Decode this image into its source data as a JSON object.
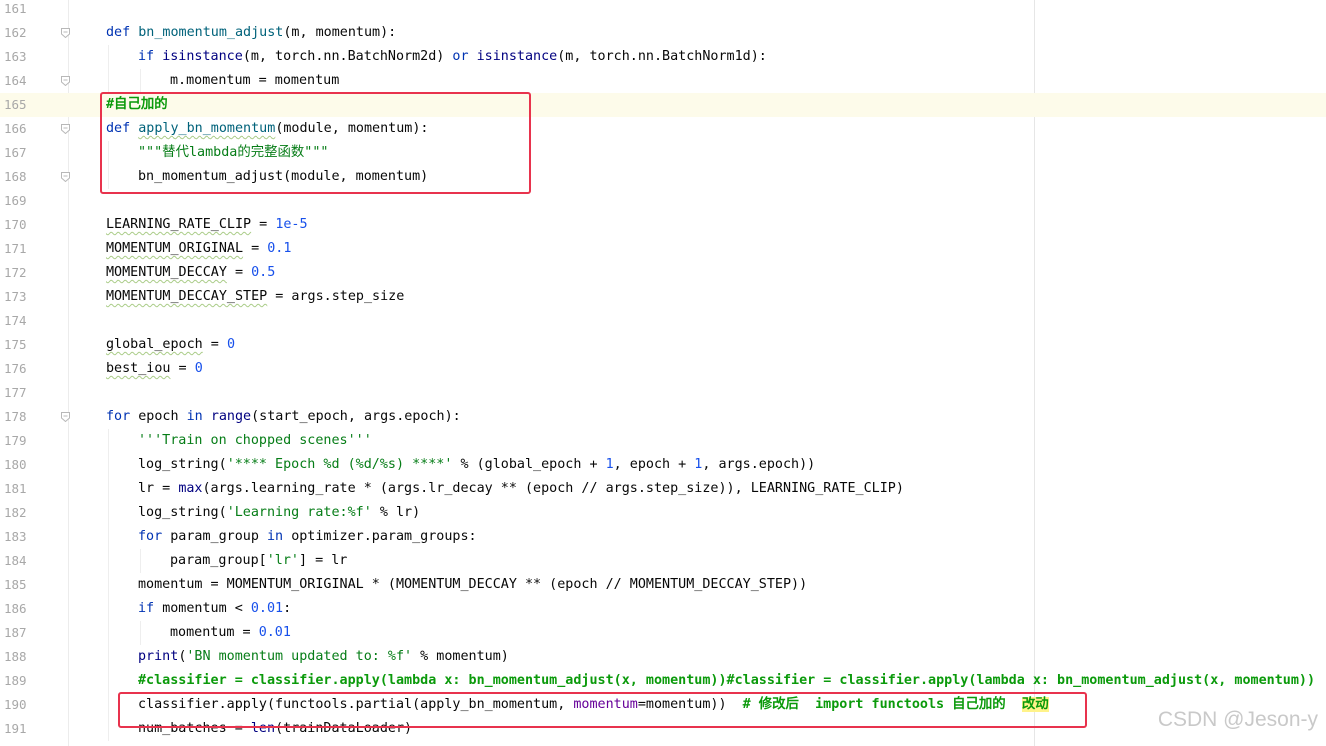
{
  "editor": {
    "lines": [
      {
        "no": "161",
        "tokens": []
      },
      {
        "no": "162",
        "tokens": [
          {
            "t": "def ",
            "c": "kw"
          },
          {
            "t": "bn_momentum_adjust",
            "c": "fn"
          },
          {
            "t": "(m, momentum):",
            "c": ""
          }
        ]
      },
      {
        "no": "163",
        "indent": 1,
        "tokens": [
          {
            "t": "if ",
            "c": "kw"
          },
          {
            "t": "isinstance",
            "c": "bi"
          },
          {
            "t": "(m, torch.nn.BatchNorm2d) ",
            "c": ""
          },
          {
            "t": "or ",
            "c": "kw"
          },
          {
            "t": "isinstance",
            "c": "bi"
          },
          {
            "t": "(m, torch.nn.BatchNorm1d):",
            "c": ""
          }
        ]
      },
      {
        "no": "164",
        "indent": 2,
        "tokens": [
          {
            "t": "m.momentum = momentum",
            "c": ""
          }
        ]
      },
      {
        "no": "165",
        "current": true,
        "tokens": [
          {
            "t": "#自己加的",
            "c": "todo"
          }
        ]
      },
      {
        "no": "166",
        "tokens": [
          {
            "t": "def ",
            "c": "kw"
          },
          {
            "t": "apply_bn_momentum",
            "c": "fn sq"
          },
          {
            "t": "(module, momentum):",
            "c": ""
          }
        ]
      },
      {
        "no": "167",
        "indent": 1,
        "tokens": [
          {
            "t": "\"\"\"替代lambda的完整函数\"\"\"",
            "c": "str"
          }
        ]
      },
      {
        "no": "168",
        "indent": 1,
        "tokens": [
          {
            "t": "bn_momentum_adjust(module, momentum)",
            "c": ""
          }
        ]
      },
      {
        "no": "169",
        "tokens": []
      },
      {
        "no": "170",
        "tokens": [
          {
            "t": "LEARNING_RATE_CLIP",
            "c": "sq"
          },
          {
            "t": " = ",
            "c": ""
          },
          {
            "t": "1e-5",
            "c": "num"
          }
        ]
      },
      {
        "no": "171",
        "tokens": [
          {
            "t": "MOMENTUM_ORIGINAL",
            "c": "sq"
          },
          {
            "t": " = ",
            "c": ""
          },
          {
            "t": "0.1",
            "c": "num"
          }
        ]
      },
      {
        "no": "172",
        "tokens": [
          {
            "t": "MOMENTUM_DECCAY",
            "c": "sq"
          },
          {
            "t": " = ",
            "c": ""
          },
          {
            "t": "0.5",
            "c": "num"
          }
        ]
      },
      {
        "no": "173",
        "tokens": [
          {
            "t": "MOMENTUM_DECCAY_STEP",
            "c": "sq"
          },
          {
            "t": " = args.step_size",
            "c": ""
          }
        ]
      },
      {
        "no": "174",
        "tokens": []
      },
      {
        "no": "175",
        "tokens": [
          {
            "t": "global_epoch",
            "c": "sq"
          },
          {
            "t": " = ",
            "c": ""
          },
          {
            "t": "0",
            "c": "num"
          }
        ]
      },
      {
        "no": "176",
        "tokens": [
          {
            "t": "best_iou",
            "c": "sq"
          },
          {
            "t": " = ",
            "c": ""
          },
          {
            "t": "0",
            "c": "num"
          }
        ]
      },
      {
        "no": "177",
        "tokens": []
      },
      {
        "no": "178",
        "tokens": [
          {
            "t": "for ",
            "c": "kw"
          },
          {
            "t": "epoch ",
            "c": ""
          },
          {
            "t": "in ",
            "c": "kw"
          },
          {
            "t": "range",
            "c": "bi"
          },
          {
            "t": "(start_epoch, args.epoch):",
            "c": ""
          }
        ]
      },
      {
        "no": "179",
        "indent": 1,
        "tokens": [
          {
            "t": "'''Train on chopped scenes'''",
            "c": "str"
          }
        ]
      },
      {
        "no": "180",
        "indent": 1,
        "tokens": [
          {
            "t": "log_string(",
            "c": ""
          },
          {
            "t": "'**** Epoch %d (%d/%s) ****'",
            "c": "str"
          },
          {
            "t": " % (global_epoch + ",
            "c": ""
          },
          {
            "t": "1",
            "c": "num"
          },
          {
            "t": ", epoch + ",
            "c": ""
          },
          {
            "t": "1",
            "c": "num"
          },
          {
            "t": ", args.epoch))",
            "c": ""
          }
        ]
      },
      {
        "no": "181",
        "indent": 1,
        "tokens": [
          {
            "t": "lr = ",
            "c": ""
          },
          {
            "t": "max",
            "c": "bi"
          },
          {
            "t": "(args.learning_rate * (args.lr_decay ** (epoch // args.step_size)), LEARNING_RATE_CLIP)",
            "c": ""
          }
        ]
      },
      {
        "no": "182",
        "indent": 1,
        "tokens": [
          {
            "t": "log_string(",
            "c": ""
          },
          {
            "t": "'Learning rate:%f'",
            "c": "str"
          },
          {
            "t": " % lr)",
            "c": ""
          }
        ]
      },
      {
        "no": "183",
        "indent": 1,
        "tokens": [
          {
            "t": "for ",
            "c": "kw"
          },
          {
            "t": "param_group ",
            "c": ""
          },
          {
            "t": "in ",
            "c": "kw"
          },
          {
            "t": "optimizer.param_groups:",
            "c": ""
          }
        ]
      },
      {
        "no": "184",
        "indent": 2,
        "tokens": [
          {
            "t": "param_group[",
            "c": ""
          },
          {
            "t": "'lr'",
            "c": "str"
          },
          {
            "t": "] = lr",
            "c": ""
          }
        ]
      },
      {
        "no": "185",
        "indent": 1,
        "tokens": [
          {
            "t": "momentum = MOMENTUM_ORIGINAL * (MOMENTUM_DECCAY ** (epoch // MOMENTUM_DECCAY_STEP))",
            "c": ""
          }
        ]
      },
      {
        "no": "186",
        "indent": 1,
        "tokens": [
          {
            "t": "if ",
            "c": "kw"
          },
          {
            "t": "momentum < ",
            "c": ""
          },
          {
            "t": "0.01",
            "c": "num"
          },
          {
            "t": ":",
            "c": ""
          }
        ]
      },
      {
        "no": "187",
        "indent": 2,
        "tokens": [
          {
            "t": "momentum = ",
            "c": ""
          },
          {
            "t": "0.01",
            "c": "num"
          }
        ]
      },
      {
        "no": "188",
        "indent": 1,
        "tokens": [
          {
            "t": "print",
            "c": "bi"
          },
          {
            "t": "(",
            "c": ""
          },
          {
            "t": "'BN momentum updated to: %f'",
            "c": "str"
          },
          {
            "t": " % momentum)",
            "c": ""
          }
        ]
      },
      {
        "no": "189",
        "indent": 1,
        "tokens": [
          {
            "t": "#classifier = classifier.apply(lambda x: bn_momentum_adjust(x, momentum))#classifier = classifier.apply(lambda x: bn_momentum_adjust(x, momentum))",
            "c": "todo"
          }
        ]
      },
      {
        "no": "190",
        "indent": 1,
        "tokens": [
          {
            "t": "classifier.apply(functools.partial(apply_bn_momentum, ",
            "c": ""
          },
          {
            "t": "momentum",
            "c": "named"
          },
          {
            "t": "=momentum))  ",
            "c": ""
          },
          {
            "t": "# 修改后  import functools 自己加的  ",
            "c": "todo"
          },
          {
            "t": "改动",
            "c": "todo hl"
          }
        ]
      },
      {
        "no": "191",
        "indent": 1,
        "tokens": [
          {
            "t": "num_batches = ",
            "c": ""
          },
          {
            "t": "len",
            "c": "bi"
          },
          {
            "t": "(trainDataLoader)",
            "c": ""
          }
        ]
      }
    ],
    "fold_markers_on": [
      "162",
      "164",
      "166",
      "168",
      "178"
    ],
    "highlight_boxes": [
      {
        "name": "highlight-box-function",
        "lines": [
          "165",
          "168"
        ]
      },
      {
        "name": "highlight-box-apply-call",
        "lines": [
          "190",
          "190"
        ]
      }
    ]
  },
  "watermark": "CSDN @Jeson-y"
}
